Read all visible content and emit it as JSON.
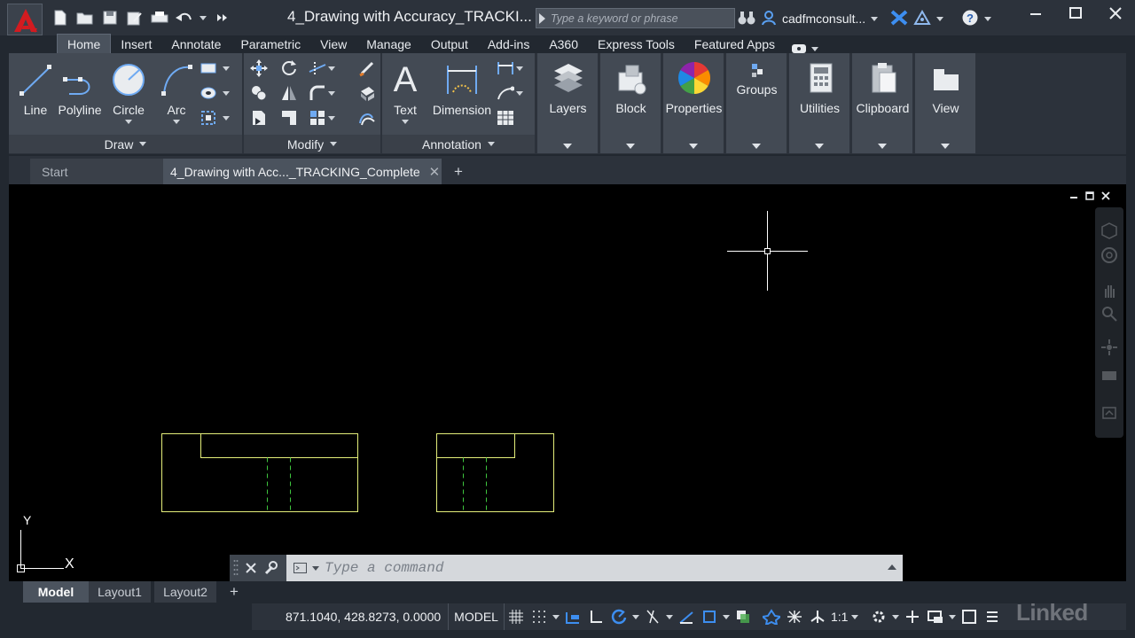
{
  "app": {
    "title": "4_Drawing with Accuracy_TRACKI...",
    "search_placeholder": "Type a keyword or phrase",
    "user": "cadfmconsult..."
  },
  "ribbon_tabs": [
    {
      "label": "Home",
      "active": true
    },
    {
      "label": "Insert"
    },
    {
      "label": "Annotate"
    },
    {
      "label": "Parametric"
    },
    {
      "label": "View"
    },
    {
      "label": "Manage"
    },
    {
      "label": "Output"
    },
    {
      "label": "Add-ins"
    },
    {
      "label": "A360"
    },
    {
      "label": "Express Tools"
    },
    {
      "label": "Featured Apps"
    }
  ],
  "ribbon": {
    "draw": {
      "title": "Draw",
      "line": "Line",
      "polyline": "Polyline",
      "circle": "Circle",
      "arc": "Arc"
    },
    "modify": {
      "title": "Modify"
    },
    "annotation": {
      "title": "Annotation",
      "text": "Text",
      "dimension": "Dimension"
    },
    "layers": "Layers",
    "block": "Block",
    "properties": "Properties",
    "groups": "Groups",
    "utilities": "Utilities",
    "clipboard": "Clipboard",
    "view": "View"
  },
  "file_tabs": {
    "start": "Start",
    "document": "4_Drawing with Acc..._TRACKING_Complete"
  },
  "ucs": {
    "x": "X",
    "y": "Y"
  },
  "command_line": {
    "placeholder": "Type a command"
  },
  "layout_tabs": [
    "Model",
    "Layout1",
    "Layout2"
  ],
  "status_bar": {
    "coordinates": "871.1040, 428.8273, 0.0000",
    "model": "MODEL",
    "scale": "1:1"
  },
  "watermark": "Linked",
  "colors": {
    "drawing_lines": "#e4ee7a",
    "hidden_lines": "#3ec63e",
    "crosshair": "#ffffff",
    "ribbon_panel": "#434a54",
    "accent_blue": "#3d8ef0",
    "logo_red": "#d31b20"
  }
}
